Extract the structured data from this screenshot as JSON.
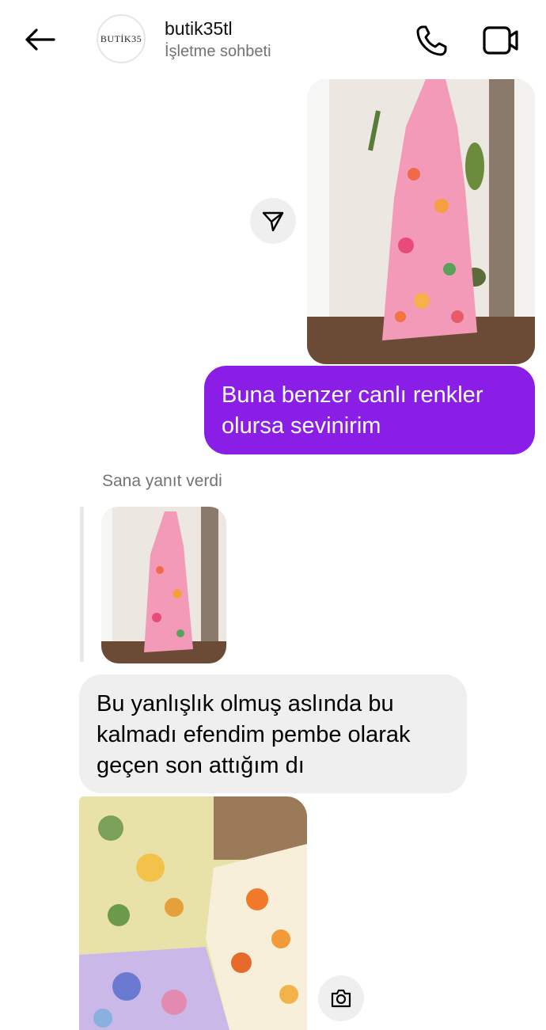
{
  "header": {
    "avatar_text": "BUTİK35",
    "title": "butik35tl",
    "subtitle": "İşletme sohbeti"
  },
  "messages": {
    "sent_text": "Buna benzer canlı renkler olursa sevinirim",
    "reply_label": "Sana yanıt verdi",
    "received_text": "Bu yanlışlık olmuş aslında bu kalmadı efendim pembe olarak geçen son attığım dı"
  },
  "colors": {
    "sent_bubble": "#8a1ee6",
    "received_bubble": "#efefef",
    "secondary_text": "#737373"
  },
  "icons": {
    "back": "arrow-left-icon",
    "call": "phone-icon",
    "video": "video-camera-icon",
    "share": "paper-plane-icon",
    "camera": "camera-icon"
  }
}
